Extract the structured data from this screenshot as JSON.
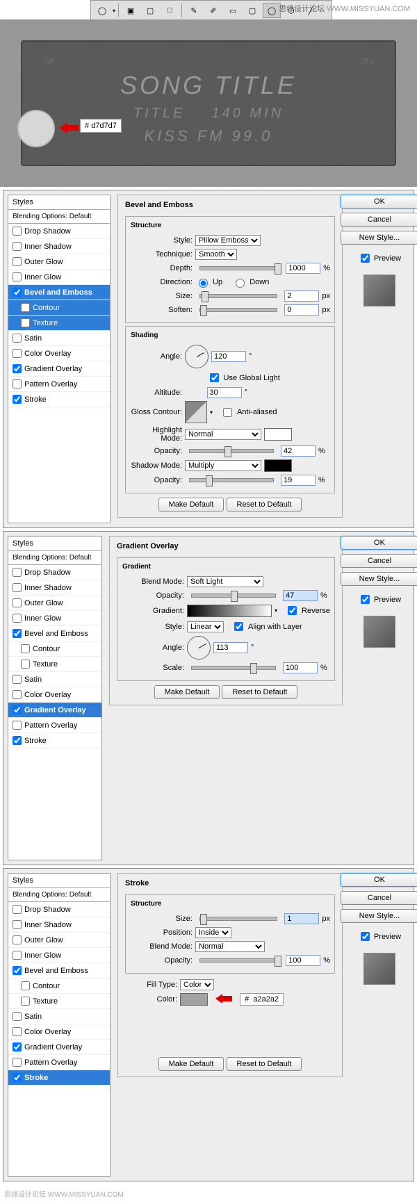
{
  "watermark": {
    "cn": "思缘设计论坛",
    "url": "WWW.MISSYUAN.COM"
  },
  "toolbar": {
    "icons": [
      "ellipse",
      "bg-square",
      "square",
      "outline-square",
      "pen",
      "freeform",
      "rect",
      "rounded-rect",
      "ellipse-shape",
      "hex",
      "line"
    ]
  },
  "radio": {
    "line1": "SONG TITLE",
    "line2a": "TITLE",
    "line2b": "140 MIN",
    "line3": "KISS FM 99.0",
    "hex_label": "#",
    "hex_value": "d7d7d7"
  },
  "styles_header": "Styles",
  "blending_label": "Blending Options: Default",
  "style_items": [
    "Drop Shadow",
    "Inner Shadow",
    "Outer Glow",
    "Inner Glow",
    "Bevel and Emboss",
    "Contour",
    "Texture",
    "Satin",
    "Color Overlay",
    "Gradient Overlay",
    "Pattern Overlay",
    "Stroke"
  ],
  "buttons": {
    "ok": "OK",
    "cancel": "Cancel",
    "new_style": "New Style...",
    "preview": "Preview",
    "make_default": "Make Default",
    "reset": "Reset to Default"
  },
  "bevel": {
    "title": "Bevel and Emboss",
    "structure": "Structure",
    "shading": "Shading",
    "style_l": "Style:",
    "style_v": "Pillow Emboss",
    "tech_l": "Technique:",
    "tech_v": "Smooth",
    "depth_l": "Depth:",
    "depth_v": "1000",
    "pct": "%",
    "dir_l": "Direction:",
    "up": "Up",
    "down": "Down",
    "size_l": "Size:",
    "size_v": "2",
    "px": "px",
    "soft_l": "Soften:",
    "soft_v": "0",
    "angle_l": "Angle:",
    "angle_v": "120",
    "deg": "°",
    "global": "Use Global Light",
    "alt_l": "Altitude:",
    "alt_v": "30",
    "gloss_l": "Gloss Contour:",
    "anti": "Anti-aliased",
    "hmode_l": "Highlight Mode:",
    "hmode_v": "Normal",
    "op_l": "Opacity:",
    "hop_v": "42",
    "smode_l": "Shadow Mode:",
    "smode_v": "Multiply",
    "sop_v": "19"
  },
  "grad": {
    "title": "Gradient Overlay",
    "gradient": "Gradient",
    "bmode_l": "Blend Mode:",
    "bmode_v": "Soft Light",
    "op_l": "Opacity:",
    "op_v": "47",
    "pct": "%",
    "grad_l": "Gradient:",
    "reverse": "Reverse",
    "style_l": "Style:",
    "style_v": "Linear",
    "align": "Align with Layer",
    "angle_l": "Angle:",
    "angle_v": "113",
    "deg": "°",
    "scale_l": "Scale:",
    "scale_v": "100"
  },
  "stroke": {
    "title": "Stroke",
    "structure": "Structure",
    "size_l": "Size:",
    "size_v": "1",
    "px": "px",
    "pos_l": "Position:",
    "pos_v": "Inside",
    "bmode_l": "Blend Mode:",
    "bmode_v": "Normal",
    "op_l": "Opacity:",
    "op_v": "100",
    "pct": "%",
    "fill_l": "Fill Type:",
    "fill_v": "Color",
    "color_l": "Color:",
    "hex_pre": "#",
    "hex_v": "a2a2a2"
  }
}
